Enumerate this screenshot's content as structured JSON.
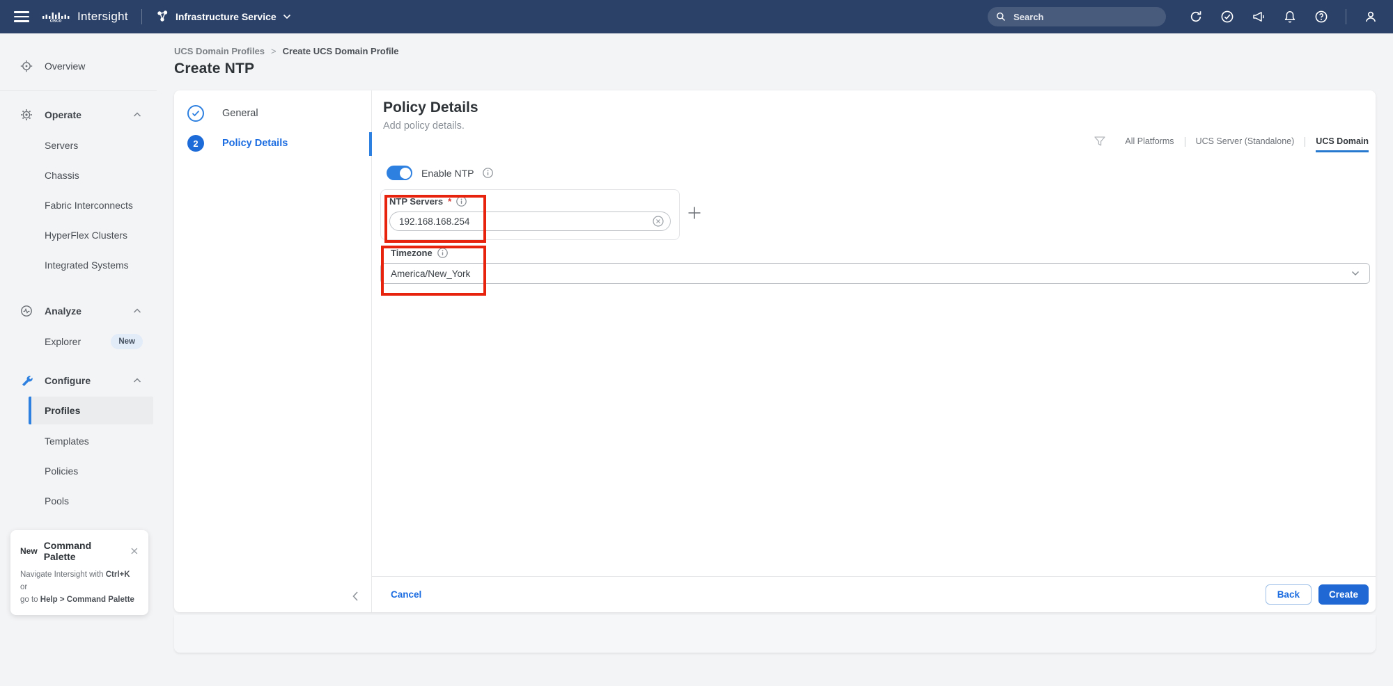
{
  "colors": {
    "topbar": "#2b4168",
    "accent": "#1f6fd4",
    "toggle_on": "#2e80e0",
    "annotation_red": "#e8230d"
  },
  "topbar": {
    "brand": "Intersight",
    "logo": "cisco",
    "service": "Infrastructure Service",
    "search_placeholder": "Search",
    "icons": [
      "refresh-icon",
      "check-circle-icon",
      "megaphone-icon",
      "bell-icon",
      "help-icon",
      "user-icon"
    ]
  },
  "sidebar": {
    "overview": "Overview",
    "operate": {
      "label": "Operate",
      "items": [
        "Servers",
        "Chassis",
        "Fabric Interconnects",
        "HyperFlex Clusters",
        "Integrated Systems"
      ]
    },
    "analyze": {
      "label": "Analyze",
      "items": [
        "Explorer"
      ],
      "badge": "New"
    },
    "configure": {
      "label": "Configure",
      "items": [
        "Profiles",
        "Templates",
        "Policies",
        "Pools"
      ],
      "active_item": "Profiles"
    },
    "command_palette": {
      "badge": "New",
      "title": "Command Palette",
      "line1_pre": "Navigate Intersight with ",
      "line1_kbd": "Ctrl+K",
      "line1_post": " or",
      "line2_pre": "go to ",
      "line2_bold": "Help > Command Palette"
    }
  },
  "page": {
    "breadcrumb": [
      "UCS Domain Profiles",
      "Create UCS Domain Profile"
    ],
    "breadcrumb_separator": ">",
    "title": "Create NTP"
  },
  "wizard": {
    "steps": [
      {
        "label": "General",
        "state": "complete"
      },
      {
        "number": "2",
        "label": "Policy Details",
        "state": "active"
      }
    ]
  },
  "main": {
    "heading": "Policy Details",
    "subheading": "Add policy details.",
    "platform_tabs": [
      {
        "label": "All Platforms",
        "selected": false
      },
      {
        "label": "UCS Server (Standalone)",
        "selected": false
      },
      {
        "label": "UCS Domain",
        "selected": true
      }
    ],
    "enable_ntp_label": "Enable NTP",
    "ntp_servers_label": "NTP Servers",
    "ntp_required_mark": "*",
    "ntp_value": "192.168.168.254",
    "timezone_label": "Timezone",
    "timezone_value": "America/New_York"
  },
  "footer": {
    "cancel": "Cancel",
    "back": "Back",
    "create": "Create"
  }
}
